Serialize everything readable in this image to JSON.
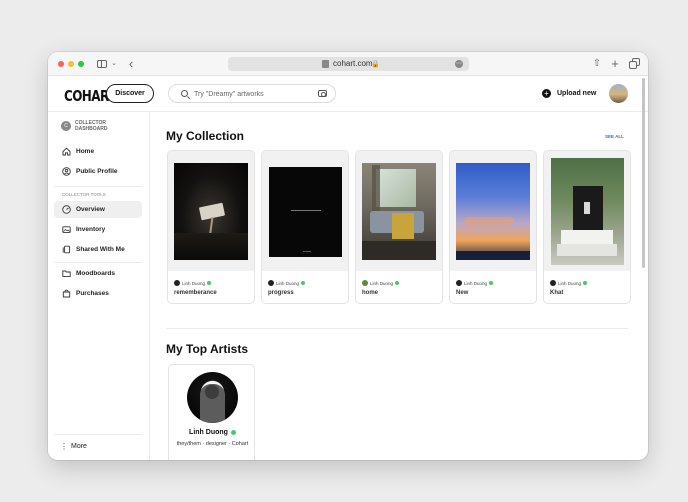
{
  "browser": {
    "url": "cohart.com",
    "icons": [
      "sidebar-icon",
      "chevron-down-icon",
      "back-arrow-icon",
      "lock-icon",
      "more-icon",
      "share-icon",
      "new-tab-icon",
      "tabs-icon"
    ]
  },
  "header": {
    "logo": "COHART",
    "discover_label": "Discover",
    "search_placeholder": "Try \"Dreamy\" artworks",
    "upload_label": "Upload new"
  },
  "sidebar": {
    "badge": "C",
    "title_line1": "COLLECTOR",
    "title_line2": "DASHBOARD",
    "primary": [
      {
        "label": "Home",
        "icon": "home-icon"
      },
      {
        "label": "Public Profile",
        "icon": "profile-icon"
      }
    ],
    "tools_label": "COLLECTOR TOOLS",
    "tools": [
      {
        "label": "Overview",
        "icon": "overview-icon",
        "active": true
      },
      {
        "label": "Inventory",
        "icon": "inventory-icon",
        "active": false
      },
      {
        "label": "Shared With Me",
        "icon": "shared-icon",
        "active": false
      }
    ],
    "secondary": [
      {
        "label": "Moodboards",
        "icon": "folder-icon"
      },
      {
        "label": "Purchases",
        "icon": "bag-icon"
      }
    ],
    "more_label": "More"
  },
  "collection": {
    "title": "My Collection",
    "see_all": "SEE ALL",
    "cards": [
      {
        "title": "rememberance",
        "author": "Linh Duong"
      },
      {
        "title": "progress",
        "author": "Linh Duong"
      },
      {
        "title": "home",
        "author": "Linh Duong"
      },
      {
        "title": "New",
        "author": "Linh Duong"
      },
      {
        "title": "Khat",
        "author": "Linh Duong"
      }
    ]
  },
  "artists": {
    "title": "My Top Artists",
    "items": [
      {
        "name": "Linh Duong",
        "bio": "they/them · designer · Cohart"
      }
    ]
  },
  "colors": {
    "accent_link": "#3b5fd9",
    "verified": "#4cc76c"
  }
}
